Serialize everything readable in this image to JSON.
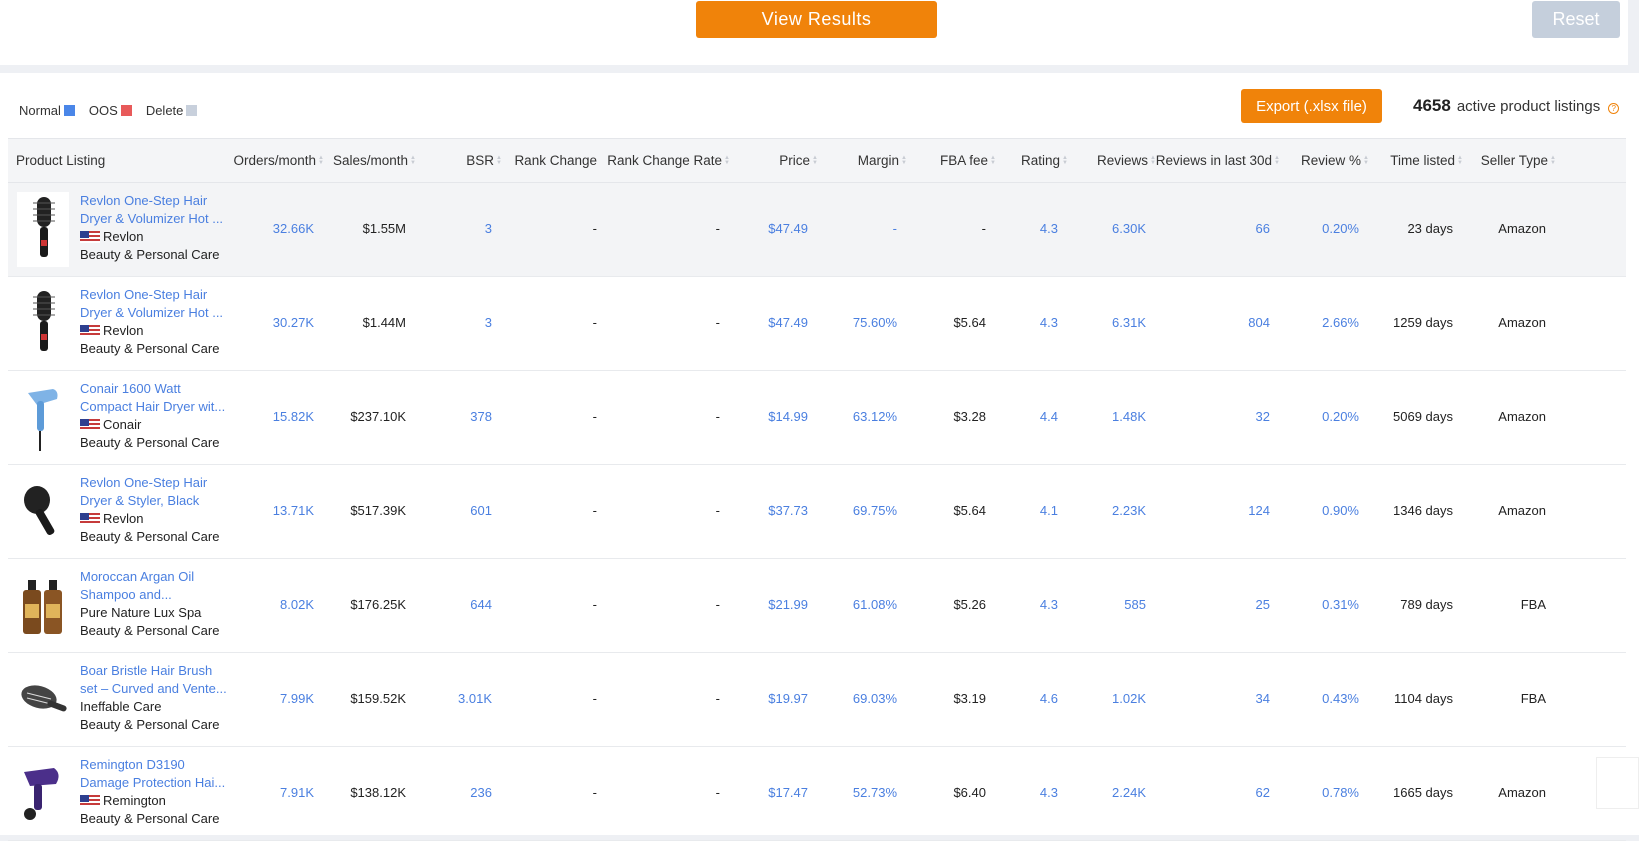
{
  "top": {
    "view_results": "View Results",
    "reset": "Reset"
  },
  "legend": [
    {
      "label": "Normal",
      "color": "#4a86e8"
    },
    {
      "label": "OOS",
      "color": "#e85a5a"
    },
    {
      "label": "Delete",
      "color": "#c8d0dc"
    }
  ],
  "toolbar": {
    "export": "Export (.xlsx file)",
    "count": "4658",
    "count_label": "active product listings",
    "help": "?"
  },
  "columns": [
    "Product Listing",
    "Orders/month",
    "Sales/month",
    "BSR",
    "Rank Change",
    "Rank Change Rate",
    "Price",
    "Margin",
    "FBA fee",
    "Rating",
    "Reviews",
    "Reviews in last 30d",
    "Review %",
    "Time listed",
    "Seller Type"
  ],
  "rows": [
    {
      "title": "Revlon One-Step Hair Dryer & Volumizer Hot ...",
      "brand": "Revlon",
      "flag": "us",
      "category": "Beauty & Personal Care",
      "image": "round-brush-dryer-icon",
      "orders": "32.66K",
      "sales": "$1.55M",
      "bsr": "3",
      "rank_change": "-",
      "rank_change_rate": "-",
      "price": "$47.49",
      "margin": "-",
      "fba_fee": "-",
      "rating": "4.3",
      "reviews": "6.30K",
      "reviews_30d": "66",
      "review_pct": "0.20%",
      "time_listed": "23 days",
      "seller_type": "Amazon"
    },
    {
      "title": "Revlon One-Step Hair Dryer & Volumizer Hot ...",
      "brand": "Revlon",
      "flag": "us",
      "category": "Beauty & Personal Care",
      "image": "round-brush-dryer-icon",
      "orders": "30.27K",
      "sales": "$1.44M",
      "bsr": "3",
      "rank_change": "-",
      "rank_change_rate": "-",
      "price": "$47.49",
      "margin": "75.60%",
      "fba_fee": "$5.64",
      "rating": "4.3",
      "reviews": "6.31K",
      "reviews_30d": "804",
      "review_pct": "2.66%",
      "time_listed": "1259 days",
      "seller_type": "Amazon"
    },
    {
      "title": "Conair 1600 Watt Compact Hair Dryer wit...",
      "brand": "Conair",
      "flag": "us",
      "category": "Beauty & Personal Care",
      "image": "hair-dryer-icon",
      "orders": "15.82K",
      "sales": "$237.10K",
      "bsr": "378",
      "rank_change": "-",
      "rank_change_rate": "-",
      "price": "$14.99",
      "margin": "63.12%",
      "fba_fee": "$3.28",
      "rating": "4.4",
      "reviews": "1.48K",
      "reviews_30d": "32",
      "review_pct": "0.20%",
      "time_listed": "5069 days",
      "seller_type": "Amazon"
    },
    {
      "title": "Revlon One-Step Hair Dryer & Styler, Black",
      "brand": "Revlon",
      "flag": "us",
      "category": "Beauty & Personal Care",
      "image": "oval-brush-dryer-icon",
      "orders": "13.71K",
      "sales": "$517.39K",
      "bsr": "601",
      "rank_change": "-",
      "rank_change_rate": "-",
      "price": "$37.73",
      "margin": "69.75%",
      "fba_fee": "$5.64",
      "rating": "4.1",
      "reviews": "2.23K",
      "reviews_30d": "124",
      "review_pct": "0.90%",
      "time_listed": "1346 days",
      "seller_type": "Amazon"
    },
    {
      "title": "Moroccan Argan Oil Shampoo and...",
      "brand": "Pure Nature Lux Spa",
      "flag": "",
      "category": "Beauty & Personal Care",
      "image": "shampoo-bottles-icon",
      "orders": "8.02K",
      "sales": "$176.25K",
      "bsr": "644",
      "rank_change": "-",
      "rank_change_rate": "-",
      "price": "$21.99",
      "margin": "61.08%",
      "fba_fee": "$5.26",
      "rating": "4.3",
      "reviews": "585",
      "reviews_30d": "25",
      "review_pct": "0.31%",
      "time_listed": "789 days",
      "seller_type": "FBA"
    },
    {
      "title": "Boar Bristle Hair Brush set – Curved and Vente...",
      "brand": "Ineffable Care",
      "flag": "",
      "category": "Beauty & Personal Care",
      "image": "hair-brush-icon",
      "orders": "7.99K",
      "sales": "$159.52K",
      "bsr": "3.01K",
      "rank_change": "-",
      "rank_change_rate": "-",
      "price": "$19.97",
      "margin": "69.03%",
      "fba_fee": "$3.19",
      "rating": "4.6",
      "reviews": "1.02K",
      "reviews_30d": "34",
      "review_pct": "0.43%",
      "time_listed": "1104 days",
      "seller_type": "FBA"
    },
    {
      "title": "Remington D3190 Damage Protection Hai...",
      "brand": "Remington",
      "flag": "us",
      "category": "Beauty & Personal Care",
      "image": "purple-dryer-icon",
      "orders": "7.91K",
      "sales": "$138.12K",
      "bsr": "236",
      "rank_change": "-",
      "rank_change_rate": "-",
      "price": "$17.47",
      "margin": "52.73%",
      "fba_fee": "$6.40",
      "rating": "4.3",
      "reviews": "2.24K",
      "reviews_30d": "62",
      "review_pct": "0.78%",
      "time_listed": "1665 days",
      "seller_type": "Amazon"
    }
  ],
  "colors": {
    "accent": "#f0830a",
    "link": "#4a7fe0",
    "reset": "#c5cfdc"
  }
}
